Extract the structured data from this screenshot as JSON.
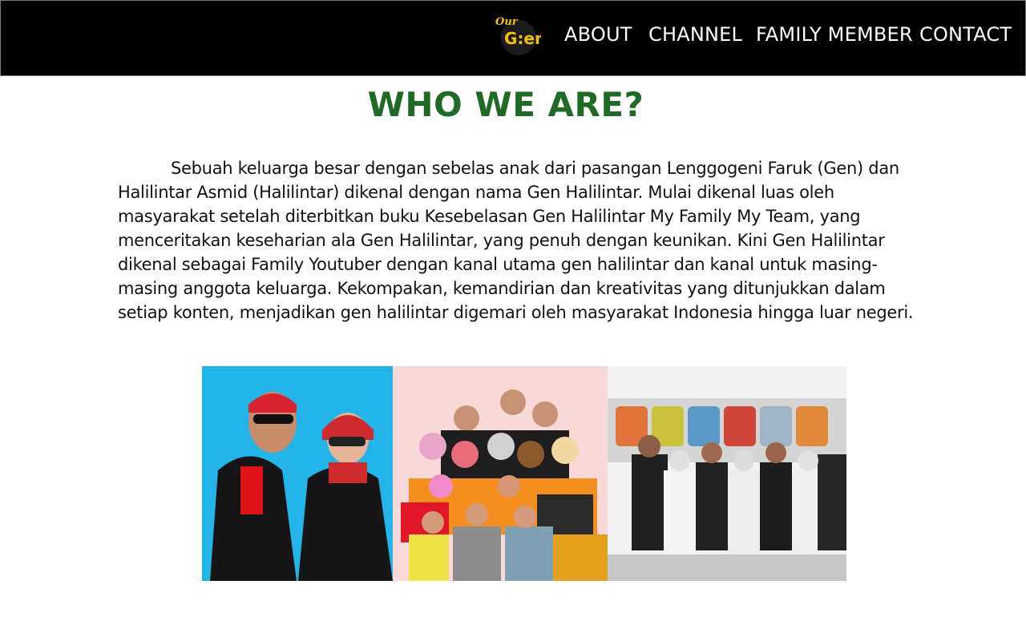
{
  "nav": {
    "logo_top": "Our",
    "logo_main": "G:en",
    "about_label": "ABOUT",
    "channel_label": "CHANNEL",
    "family_label": "FAMILY MEMBER",
    "contact_label": "CONTACT"
  },
  "main": {
    "title": "WHO WE ARE?",
    "paragraph": "Sebuah keluarga besar dengan sebelas anak dari pasangan Lenggogeni Faruk (Gen) dan Halilintar Asmid (Halilintar)  dikenal dengan nama Gen Halilintar.  Mulai dikenal luas oleh masyarakat setelah diterbitkan buku Kesebelasan Gen Halilintar My Family My Team, yang menceritakan keseharian ala Gen Halilintar, yang penuh dengan keunikan. Kini Gen Halilintar dikenal sebagai Family Youtuber dengan kanal utama gen halilintar dan kanal untuk masing-masing anggota keluarga. Kekompakan, kemandirian dan kreativitas yang ditunjukkan dalam setiap konten, menjadikan gen halilintar digemari oleh masyarakat Indonesia hingga luar negeri."
  },
  "colors": {
    "navbar_bg": "#000000",
    "title_green": "#1f6b25",
    "logo_yellow": "#f2c200"
  }
}
